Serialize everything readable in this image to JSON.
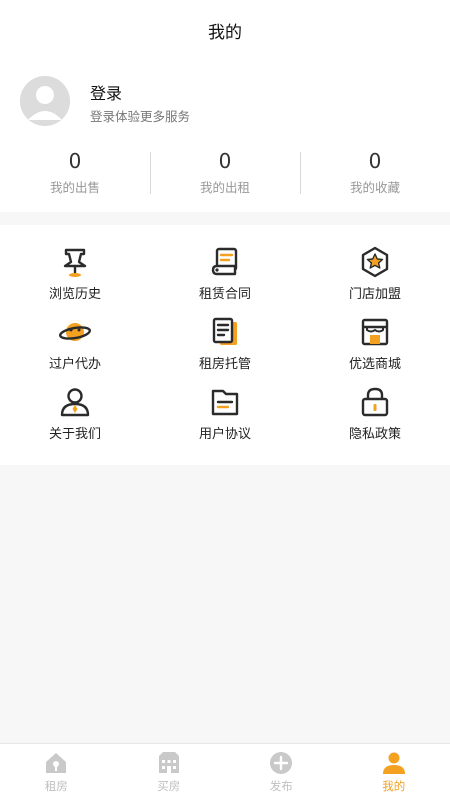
{
  "header": {
    "title": "我的"
  },
  "profile": {
    "login_title": "登录",
    "login_subtitle": "登录体验更多服务"
  },
  "stats": [
    {
      "value": "0",
      "label": "我的出售"
    },
    {
      "value": "0",
      "label": "我的出租"
    },
    {
      "value": "0",
      "label": "我的收藏"
    }
  ],
  "menu": [
    {
      "label": "浏览历史",
      "icon": "pushpin-icon"
    },
    {
      "label": "租赁合同",
      "icon": "scroll-contract-icon"
    },
    {
      "label": "门店加盟",
      "icon": "hexagon-star-icon"
    },
    {
      "label": "过户代办",
      "icon": "planet-icon"
    },
    {
      "label": "租房托管",
      "icon": "document-list-icon"
    },
    {
      "label": "优选商城",
      "icon": "storefront-icon"
    },
    {
      "label": "关于我们",
      "icon": "person-icon"
    },
    {
      "label": "用户协议",
      "icon": "folder-doc-icon"
    },
    {
      "label": "隐私政策",
      "icon": "padlock-icon"
    }
  ],
  "tabs": [
    {
      "label": "租房",
      "icon": "house-icon",
      "active": false
    },
    {
      "label": "买房",
      "icon": "building-icon",
      "active": false
    },
    {
      "label": "发布",
      "icon": "plus-circle-icon",
      "active": false
    },
    {
      "label": "我的",
      "icon": "user-icon",
      "active": true
    }
  ],
  "colors": {
    "accent": "#f4a021",
    "icon_dark": "#2b2b2b",
    "inactive": "#bfbfbf"
  }
}
